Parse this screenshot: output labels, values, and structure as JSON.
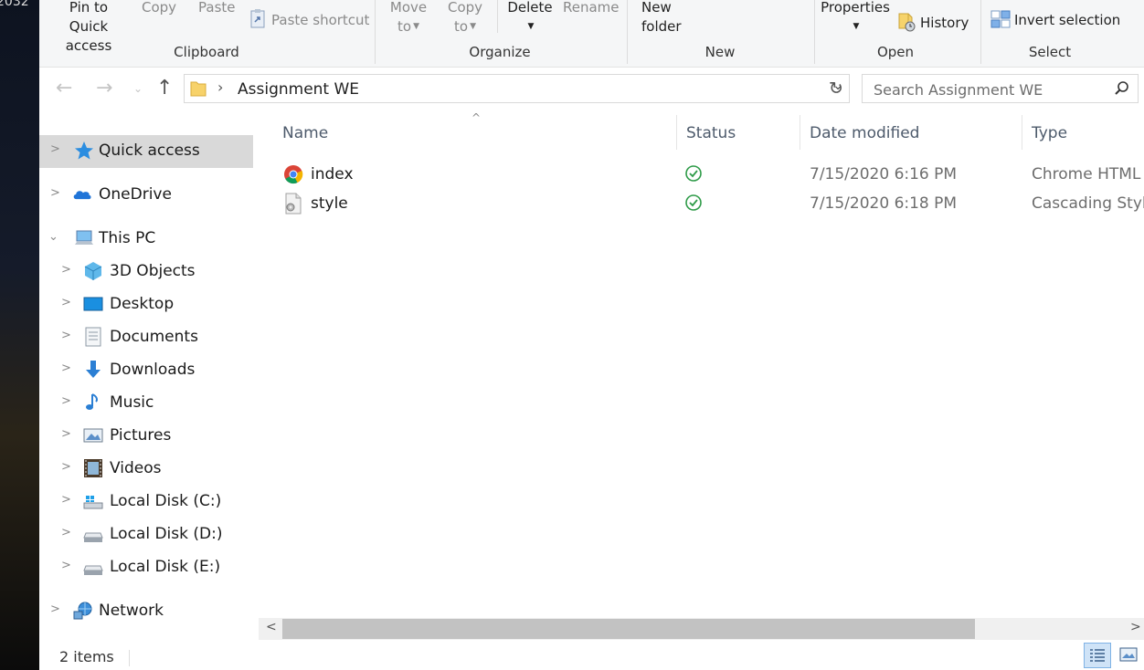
{
  "desktop": {
    "clock": "2032"
  },
  "ribbon": {
    "pin_quick_access": "Pin to Quick access",
    "copy": "Copy",
    "paste": "Paste",
    "paste_shortcut": "Paste shortcut",
    "move_to": "Move to",
    "copy_to": "Copy to",
    "delete": "Delete",
    "rename": "Rename",
    "new_folder": "New folder",
    "properties": "Properties",
    "history": "History",
    "invert_selection": "Invert selection",
    "groups": {
      "clipboard": "Clipboard",
      "organize": "Organize",
      "new": "New",
      "open": "Open",
      "select": "Select"
    }
  },
  "address": {
    "path": "Assignment WE",
    "search_placeholder": "Search Assignment WE"
  },
  "sidebar": {
    "items": [
      {
        "label": "Quick access",
        "icon": "star-icon"
      },
      {
        "label": "OneDrive",
        "icon": "cloud-icon"
      },
      {
        "label": "This PC",
        "icon": "computer-icon"
      },
      {
        "label": "3D Objects",
        "icon": "cube-icon"
      },
      {
        "label": "Desktop",
        "icon": "desktop-icon"
      },
      {
        "label": "Documents",
        "icon": "document-icon"
      },
      {
        "label": "Downloads",
        "icon": "download-arrow-icon"
      },
      {
        "label": "Music",
        "icon": "music-note-icon"
      },
      {
        "label": "Pictures",
        "icon": "picture-icon"
      },
      {
        "label": "Videos",
        "icon": "film-icon"
      },
      {
        "label": "Local Disk (C:)",
        "icon": "windows-drive-icon"
      },
      {
        "label": "Local Disk (D:)",
        "icon": "drive-icon"
      },
      {
        "label": "Local Disk (E:)",
        "icon": "drive-icon"
      },
      {
        "label": "Network",
        "icon": "network-icon"
      }
    ]
  },
  "columns": {
    "name": "Name",
    "status": "Status",
    "date_modified": "Date modified",
    "type": "Type"
  },
  "files": [
    {
      "name": "index",
      "date": "7/15/2020 6:16 PM",
      "type": "Chrome HTML D",
      "icon": "chrome-icon"
    },
    {
      "name": "style",
      "date": "7/15/2020 6:18 PM",
      "type": "Cascading Style",
      "icon": "css-file-icon"
    }
  ],
  "status_bar": {
    "item_count": "2 items"
  },
  "colors": {
    "accent": "#1a73e8",
    "sync_ok": "#2e9b48",
    "selected_bg": "#d9d9d9"
  }
}
